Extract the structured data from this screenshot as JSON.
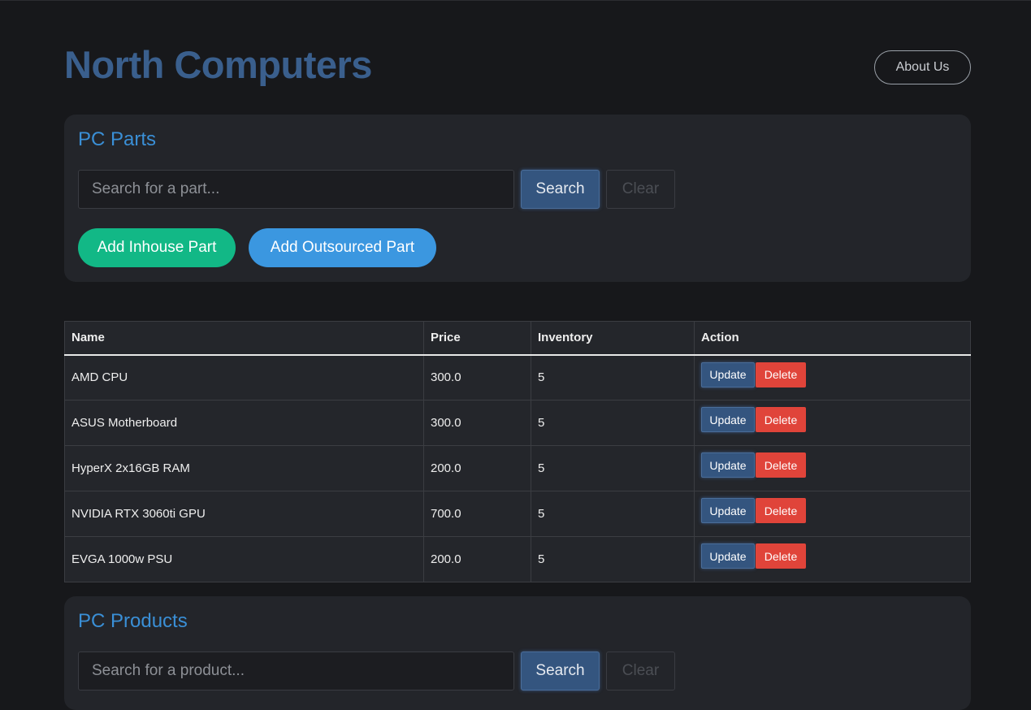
{
  "header": {
    "brand": "North Computers",
    "about_label": "About Us"
  },
  "parts_panel": {
    "title": "PC Parts",
    "search_placeholder": "Search for a part...",
    "search_label": "Search",
    "clear_label": "Clear",
    "add_inhouse_label": "Add Inhouse Part",
    "add_outsourced_label": "Add Outsourced Part"
  },
  "parts_table": {
    "columns": [
      "Name",
      "Price",
      "Inventory",
      "Action"
    ],
    "update_label": "Update",
    "delete_label": "Delete",
    "rows": [
      {
        "name": "AMD CPU",
        "price": "300.0",
        "inventory": "5"
      },
      {
        "name": "ASUS Motherboard",
        "price": "300.0",
        "inventory": "5"
      },
      {
        "name": "HyperX 2x16GB RAM",
        "price": "200.0",
        "inventory": "5"
      },
      {
        "name": "NVIDIA RTX 3060ti GPU",
        "price": "700.0",
        "inventory": "5"
      },
      {
        "name": "EVGA 1000w PSU",
        "price": "200.0",
        "inventory": "5"
      }
    ]
  },
  "products_panel": {
    "title": "PC Products",
    "search_placeholder": "Search for a product...",
    "search_label": "Search",
    "clear_label": "Clear"
  }
}
